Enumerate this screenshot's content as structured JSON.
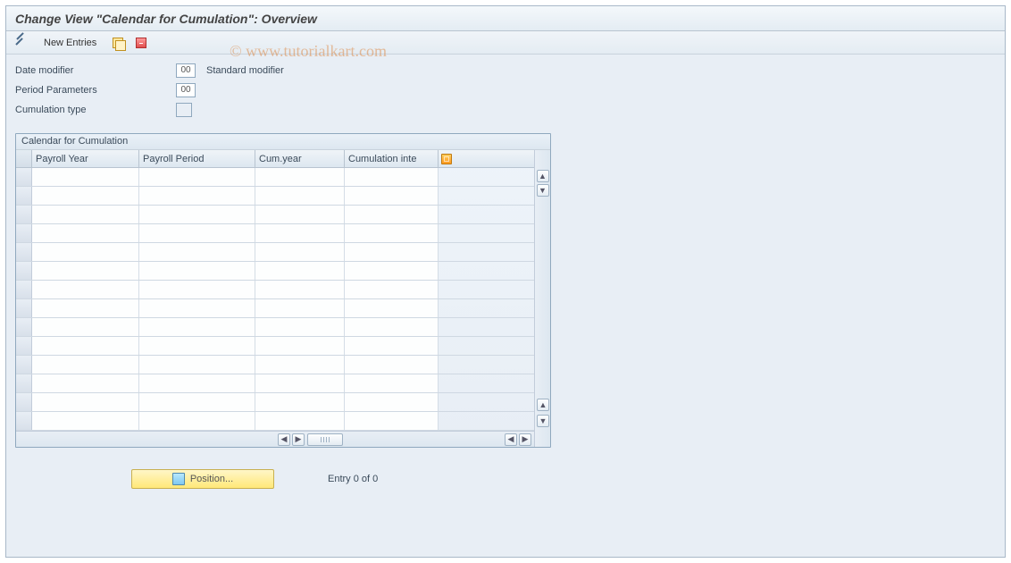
{
  "title": "Change View \"Calendar for Cumulation\": Overview",
  "watermark": "© www.tutorialkart.com",
  "toolbar": {
    "new_entries": "New Entries"
  },
  "form": {
    "date_modifier_label": "Date modifier",
    "date_modifier_value": "00",
    "date_modifier_desc": "Standard modifier",
    "period_params_label": "Period Parameters",
    "period_params_value": "00",
    "cumulation_type_label": "Cumulation type",
    "cumulation_type_value": ""
  },
  "panel": {
    "title": "Calendar for Cumulation",
    "columns": {
      "c1": "Payroll Year",
      "c2": "Payroll Period",
      "c3": "Cum.year",
      "c4": "Cumulation inte"
    }
  },
  "footer": {
    "position_label": "Position...",
    "entry_text": "Entry 0 of 0"
  }
}
